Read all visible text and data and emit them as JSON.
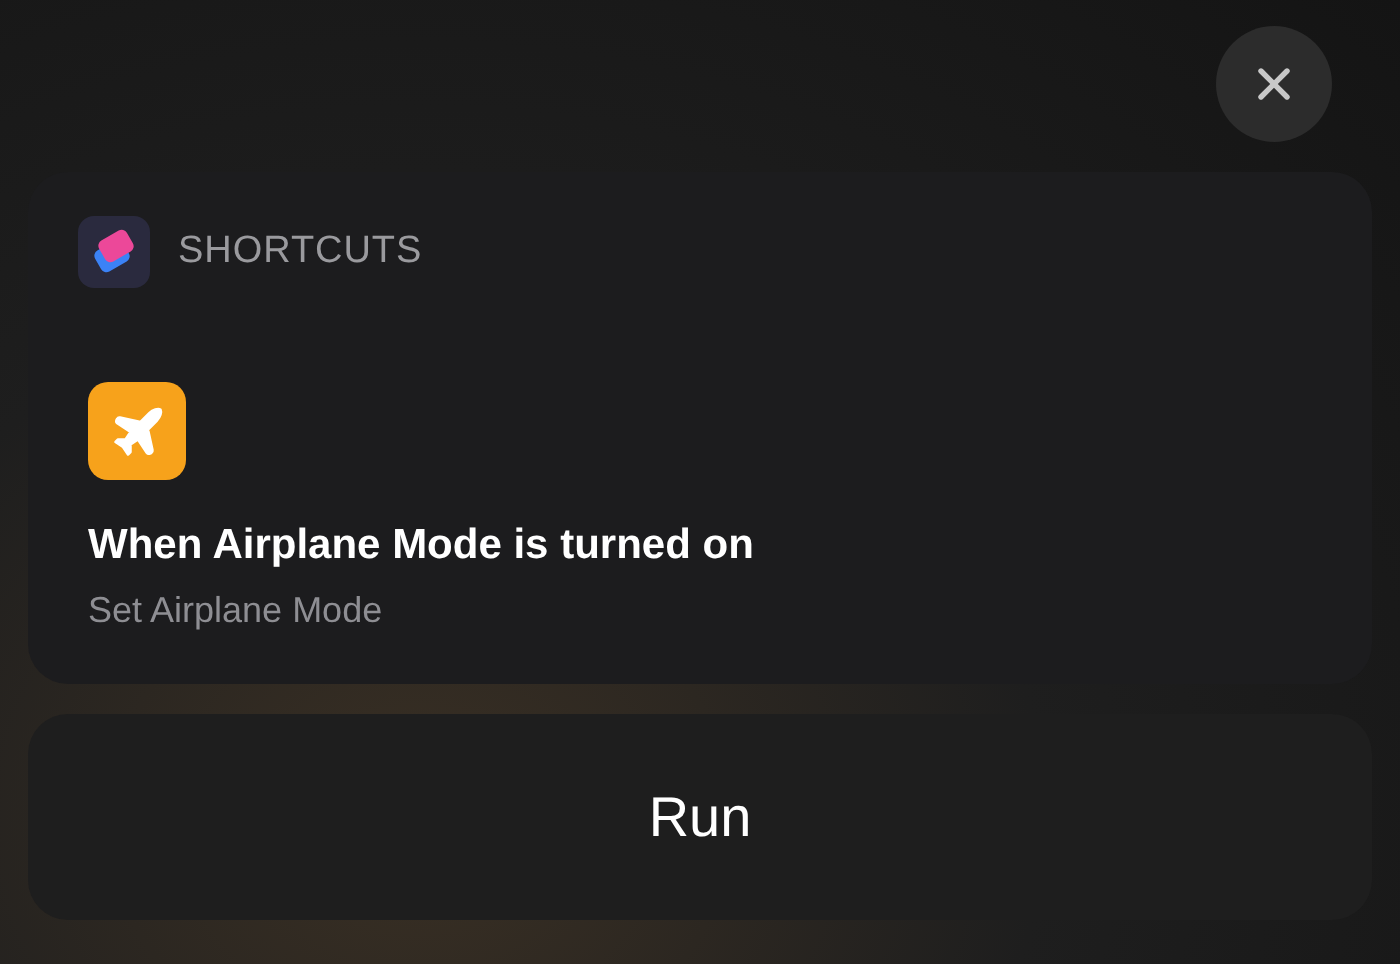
{
  "widget": {
    "app_name": "SHORTCUTS",
    "title": "When Airplane Mode is turned on",
    "subtitle": "Set Airplane Mode"
  },
  "run_button": {
    "label": "Run"
  }
}
